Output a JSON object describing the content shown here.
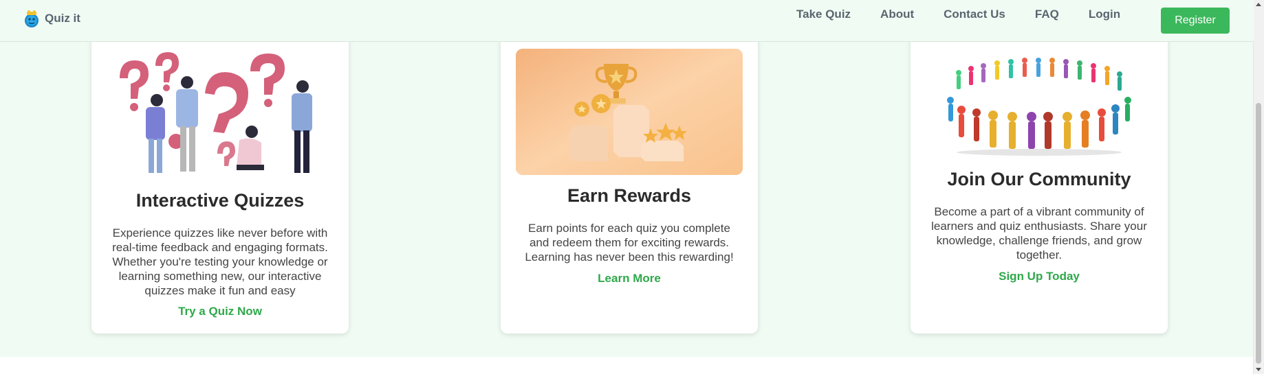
{
  "nav": {
    "brand": "Quiz it",
    "links": [
      "Take Quiz",
      "About",
      "Contact Us",
      "FAQ",
      "Login"
    ],
    "register": "Register"
  },
  "cards": [
    {
      "title": "Interactive Quizzes",
      "description": "Experience quizzes like never before with real-time feedback and engaging formats. Whether you're testing your knowledge or learning something new, our interactive quizzes make it fun and easy",
      "link": "Try a Quiz Now"
    },
    {
      "title": "Earn Rewards",
      "description": "Earn points for each quiz you complete and redeem them for exciting rewards. Learning has never been this rewarding!",
      "link": "Learn More"
    },
    {
      "title": "Join Our Community",
      "description": "Become a part of a vibrant community of learners and quiz enthusiasts. Share your knowledge, challenge friends, and grow together.",
      "link": "Sign Up Today"
    }
  ],
  "colors": {
    "accent": "#3cb85c",
    "link": "#2ea84a",
    "section_bg": "#f0fcf3"
  }
}
